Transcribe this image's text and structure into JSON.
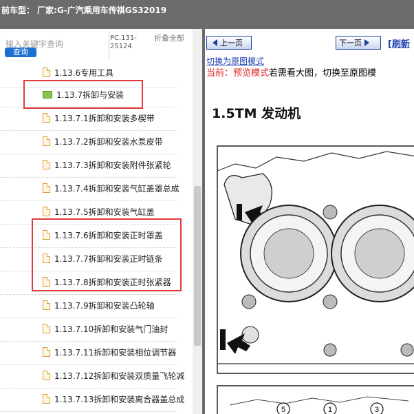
{
  "window": {
    "title": "前车型：  厂家:G-广汽乘用车传祺GS32019"
  },
  "search": {
    "placeholder": "输入关键字查询",
    "button_label": "查询",
    "code": "PC.131-25124",
    "collapse_all": "折叠全部"
  },
  "tree": {
    "items": [
      {
        "label": "1.13.6专用工具",
        "icon": "file-icon"
      },
      {
        "label": "1.13.7拆卸与安装",
        "icon": "folder-open-icon"
      },
      {
        "label": "1.13.7.1拆卸和安装多楔带",
        "icon": "file-icon"
      },
      {
        "label": "1.13.7.2拆卸和安装水泵皮带",
        "icon": "file-icon"
      },
      {
        "label": "1.13.7.3拆卸和安装附件张紧轮",
        "icon": "file-icon"
      },
      {
        "label": "1.13.7.4拆卸和安装气缸盖罩总成",
        "icon": "file-icon"
      },
      {
        "label": "1.13.7.5拆卸和安装气缸盖",
        "icon": "file-icon"
      },
      {
        "label": "1.13.7.6拆卸和安装正时罩盖",
        "icon": "file-icon"
      },
      {
        "label": "1.13.7.7拆卸和安装正时链条",
        "icon": "file-icon"
      },
      {
        "label": "1.13.7.8拆卸和安装正时张紧器",
        "icon": "file-icon"
      },
      {
        "label": "1.13.7.9拆卸和安装凸轮轴",
        "icon": "file-icon"
      },
      {
        "label": "1.13.7.10拆卸和安装气门油封",
        "icon": "file-icon"
      },
      {
        "label": "1.13.7.11拆卸和安装相位调节器",
        "icon": "file-icon"
      },
      {
        "label": "1.13.7.12拆卸和安装双质量飞轮减",
        "icon": "file-icon"
      },
      {
        "label": "1.13.7.13拆卸和安装离合器盖总成",
        "icon": "file-icon"
      }
    ]
  },
  "viewer": {
    "prev_label": "上一页",
    "next_label": "下一页",
    "refresh_label": "[刷新",
    "switch_link": "切换为原图模式",
    "mode_prefix": "当前：预览模式",
    "mode_suffix": "若需看大图，切换至原图模",
    "doc_title": "1.5TM 发动机",
    "callouts": [
      "5",
      "1",
      "3"
    ]
  },
  "colors": {
    "title_bar": "#6b6b6b",
    "highlight": "#e03a3a",
    "query_button": "#1c6fd1",
    "link": "#1b3fb0"
  }
}
